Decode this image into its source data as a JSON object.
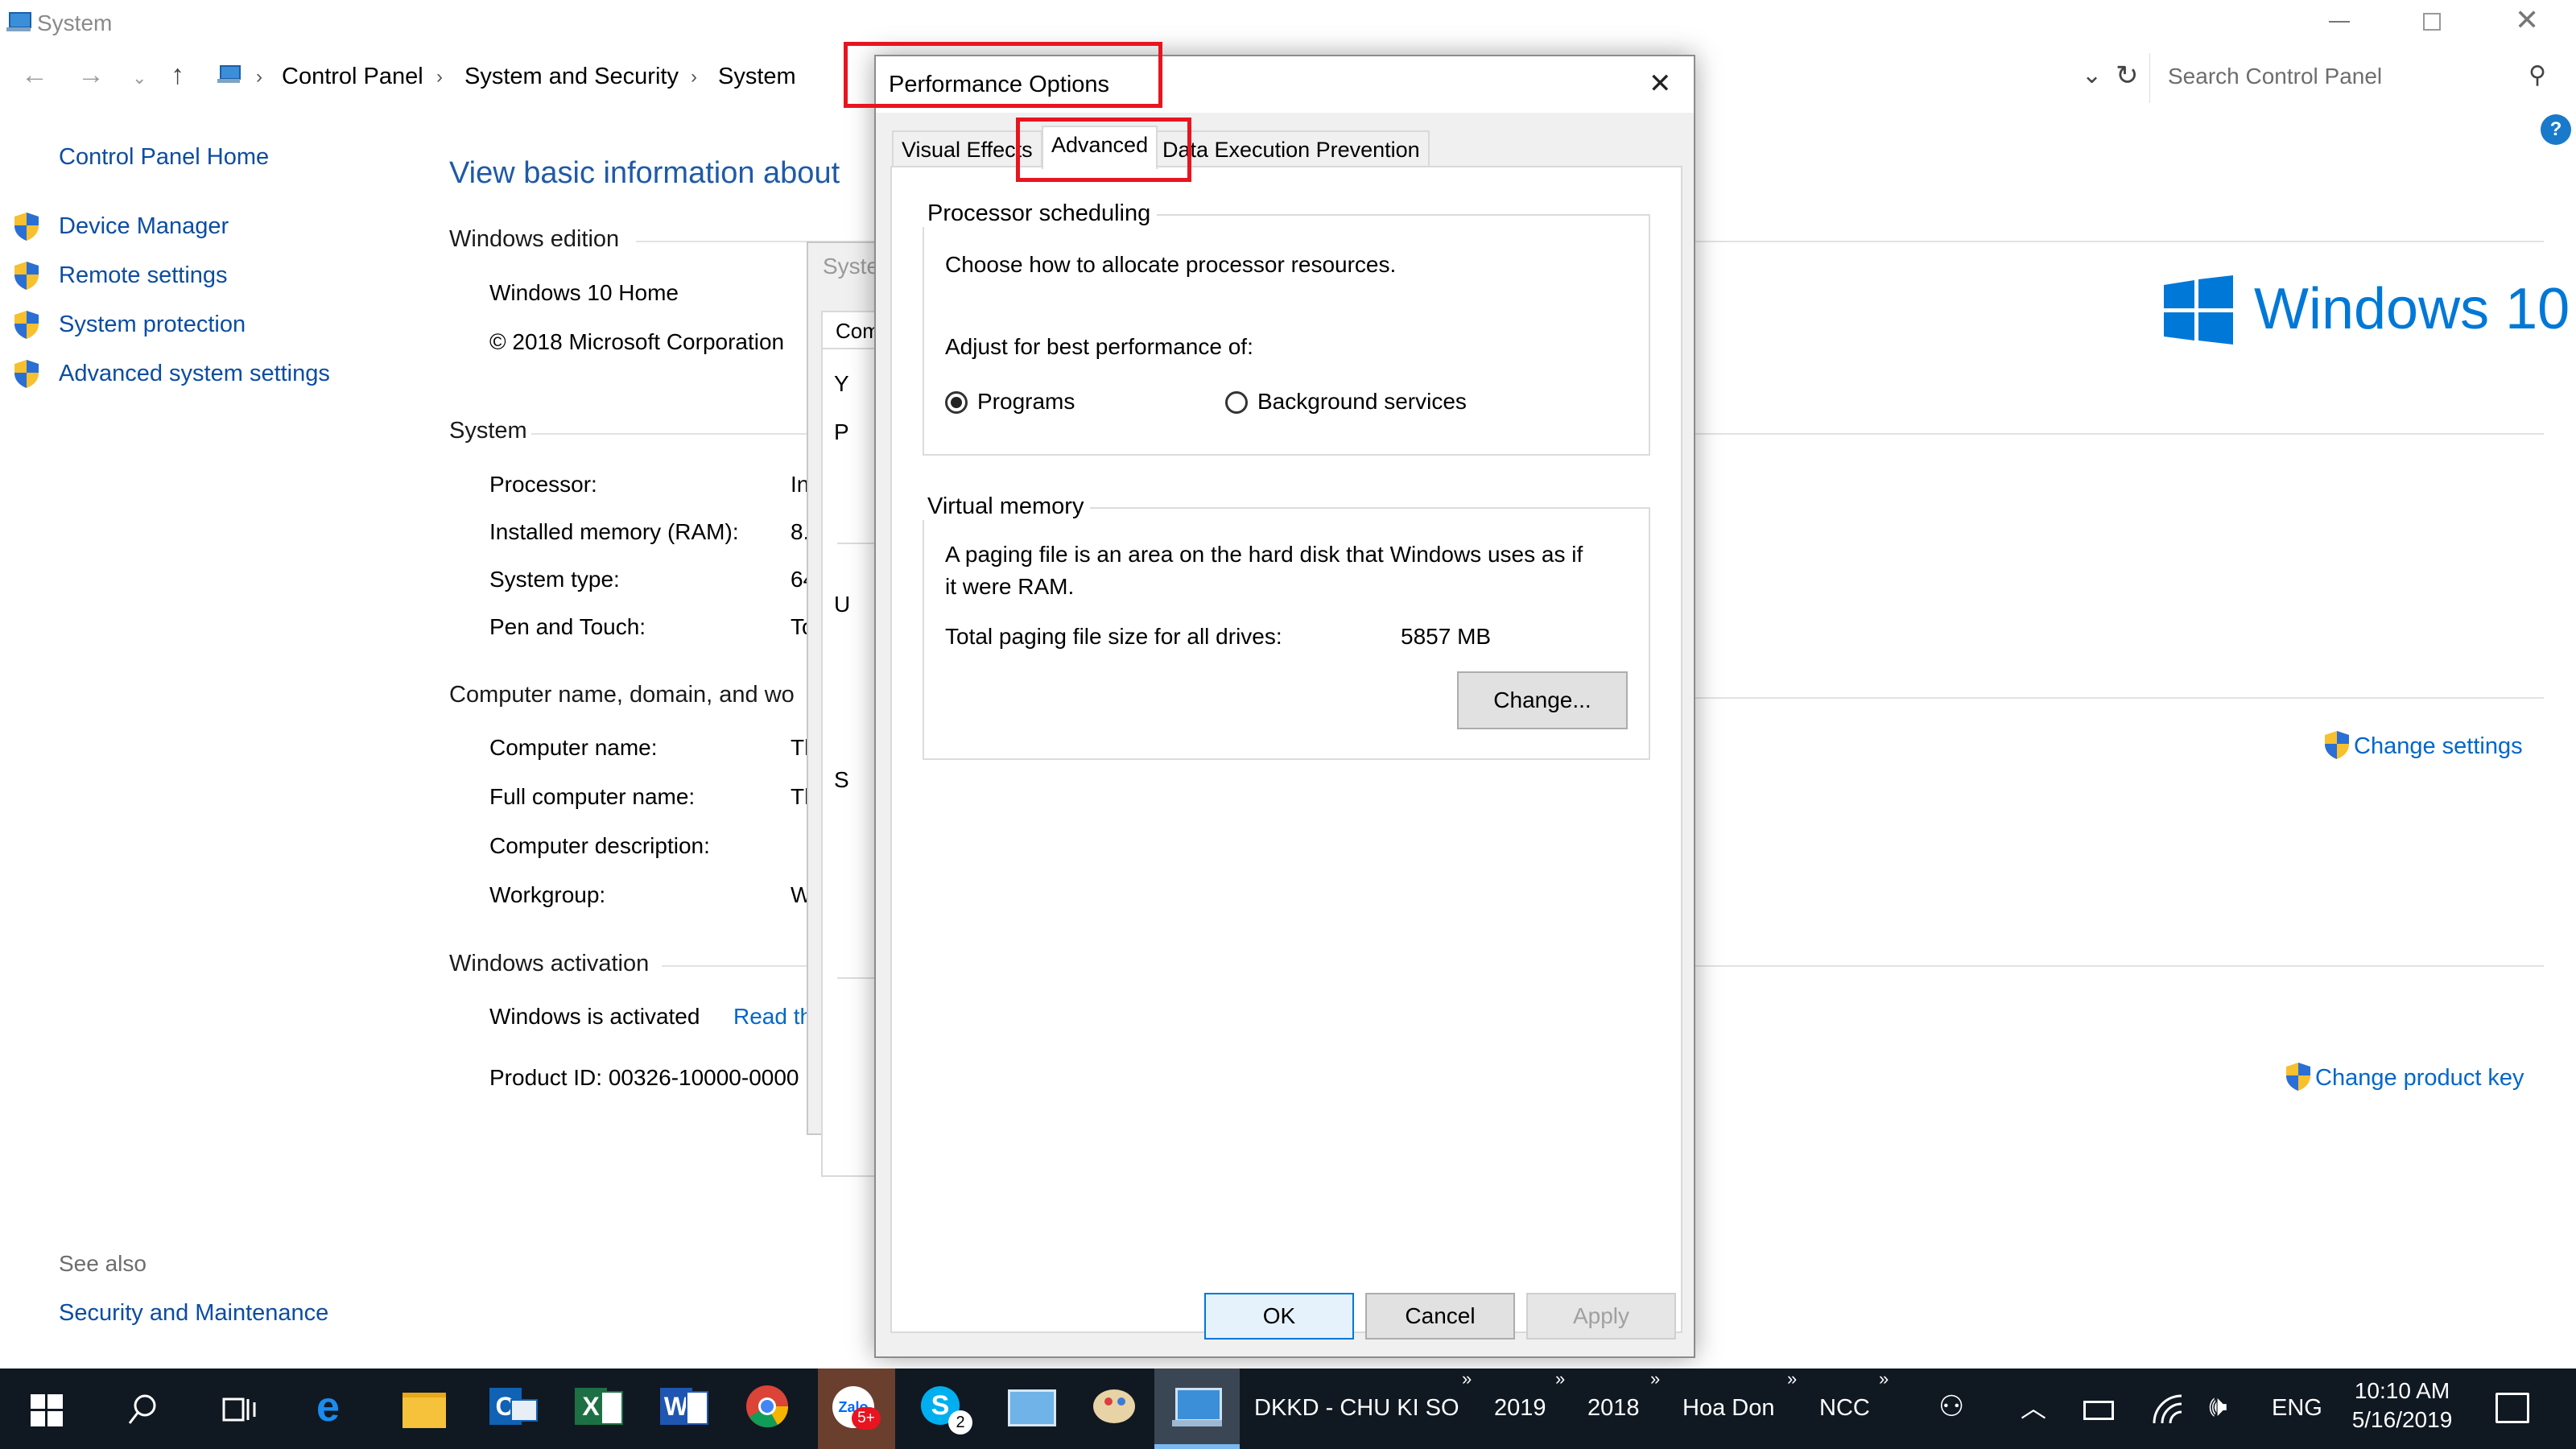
{
  "window": {
    "title": "System",
    "controls": [
      "minimize-icon",
      "restore-icon",
      "close-icon"
    ]
  },
  "address": {
    "crumbs": [
      "Control Panel",
      "System and Security",
      "System"
    ],
    "search_placeholder": "Search Control Panel"
  },
  "sidebar": {
    "home": "Control Panel Home",
    "links": [
      "Device Manager",
      "Remote settings",
      "System protection",
      "Advanced system settings"
    ],
    "see_also_label": "See also",
    "see_also_link": "Security and Maintenance"
  },
  "main": {
    "heading": "View basic information about",
    "edition_head": "Windows edition",
    "edition": "Windows 10 Home",
    "copyright": "© 2018 Microsoft Corporation",
    "system_head": "System",
    "processor_label": "Processor:",
    "processor_value": "In",
    "ram_label": "Installed memory (RAM):",
    "ram_value": "8.",
    "systype_label": "System type:",
    "systype_value": "64",
    "pen_label": "Pen and Touch:",
    "pen_value": "To",
    "computer_head": "Computer name, domain, and wo",
    "compname_label": "Computer name:",
    "compname_value": "Th",
    "fullname_label": "Full computer name:",
    "fullname_value": "Th",
    "desc_label": "Computer description:",
    "workgroup_label": "Workgroup:",
    "workgroup_value": "W",
    "activation_head": "Windows activation",
    "activated": "Windows is activated",
    "read_link": "Read th",
    "product_id": "Product ID:  00326-10000-0000",
    "logo_text": "Windows 10",
    "change_settings": "Change settings",
    "change_key": "Change product key"
  },
  "background_dialog": {
    "title": "Syste",
    "tab": "Com",
    "fragments": [
      "Y",
      "P",
      "U",
      "S"
    ]
  },
  "perf": {
    "title": "Performance Options",
    "tabs": [
      "Visual Effects",
      "Advanced",
      "Data Execution Prevention"
    ],
    "active_tab": "Advanced",
    "proc_group": "Processor scheduling",
    "proc_desc": "Choose how to allocate processor resources.",
    "adjust_label": "Adjust for best performance of:",
    "radio_programs": "Programs",
    "radio_background": "Background services",
    "selected_radio": "Programs",
    "vm_group": "Virtual memory",
    "vm_desc_1": "A paging file is an area on the hard disk that Windows uses as if",
    "vm_desc_2": "it were RAM.",
    "vm_total_label": "Total paging file size for all drives:",
    "vm_total_value": "5857 MB",
    "change_btn": "Change...",
    "ok_btn": "OK",
    "cancel_btn": "Cancel",
    "apply_btn": "Apply"
  },
  "taskbar": {
    "labels": [
      "DKKD - CHU KI SO",
      "2019",
      "2018",
      "Hoa Don",
      "NCC"
    ],
    "lang": "ENG",
    "time": "10:10 AM",
    "date": "5/16/2019",
    "zalo_badge": "5+",
    "skype_badge": "2"
  },
  "colors": {
    "link": "#0b4da2",
    "highlight_box": "#e8141f",
    "windows_blue": "#0078d7",
    "taskbar": "#101822"
  }
}
